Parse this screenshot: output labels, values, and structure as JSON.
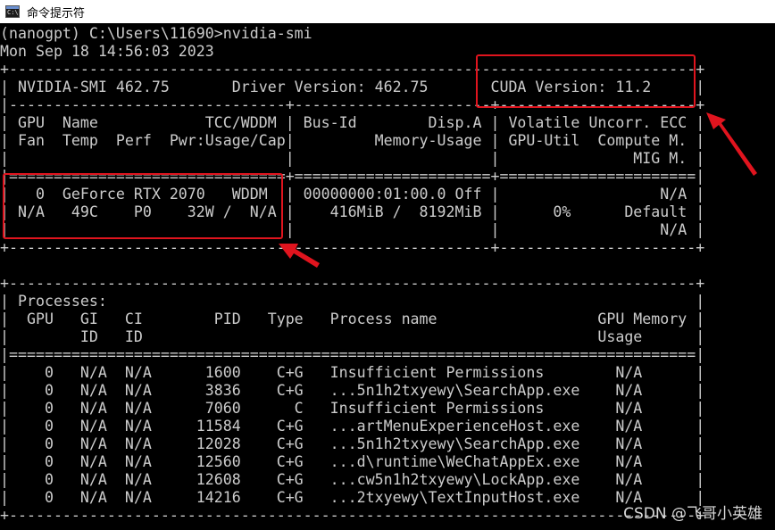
{
  "window": {
    "title": "命令提示符",
    "icon": "cmd-window-icon"
  },
  "console": {
    "lines": [
      "(nanogpt) C:\\Users\\11690>nvidia-smi",
      "Mon Sep 18 14:56:03 2023",
      "+-----------------------------------------------------------------------------+",
      "| NVIDIA-SMI 462.75       Driver Version: 462.75       CUDA Version: 11.2     |",
      "|-------------------------------+----------------------+----------------------+",
      "| GPU  Name            TCC/WDDM | Bus-Id        Disp.A | Volatile Uncorr. ECC |",
      "| Fan  Temp  Perf  Pwr:Usage/Cap|         Memory-Usage | GPU-Util  Compute M. |",
      "|                               |                      |               MIG M. |",
      "|===============================+======================+======================|",
      "|   0  GeForce RTX 2070   WDDM  | 00000000:01:00.0 Off |                  N/A |",
      "| N/A   49C    P0    32W /  N/A |    416MiB /  8192MiB |      0%      Default |",
      "|                               |                      |                  N/A |",
      "+-------------------------------+----------------------+----------------------+",
      "",
      "+-----------------------------------------------------------------------------+",
      "| Processes:                                                                  |",
      "|  GPU   GI   CI        PID   Type   Process name                  GPU Memory |",
      "|        ID   ID                                                   Usage      |",
      "|=============================================================================|",
      "|    0   N/A  N/A      1600    C+G   Insufficient Permissions        N/A      |",
      "|    0   N/A  N/A      3836    C+G   ...5n1h2txyewy\\SearchApp.exe    N/A      |",
      "|    0   N/A  N/A      7060      C   Insufficient Permissions        N/A      |",
      "|    0   N/A  N/A     11584    C+G   ...artMenuExperienceHost.exe    N/A      |",
      "|    0   N/A  N/A     12028    C+G   ...5n1h2txyewy\\SearchApp.exe    N/A      |",
      "|    0   N/A  N/A     12560    C+G   ...d\\runtime\\WeChatAppEx.exe    N/A      |",
      "|    0   N/A  N/A     12608    C+G   ...cw5n1h2txyewy\\LockApp.exe    N/A      |",
      "|    0   N/A  N/A     14216    C+G   ...2txyewy\\TextInputHost.exe    N/A      |",
      "+-----------------------------------------------------------------------------+"
    ]
  },
  "annotations": {
    "color": "#e0141e"
  },
  "watermark": "CSDN @飞哥小英雄"
}
